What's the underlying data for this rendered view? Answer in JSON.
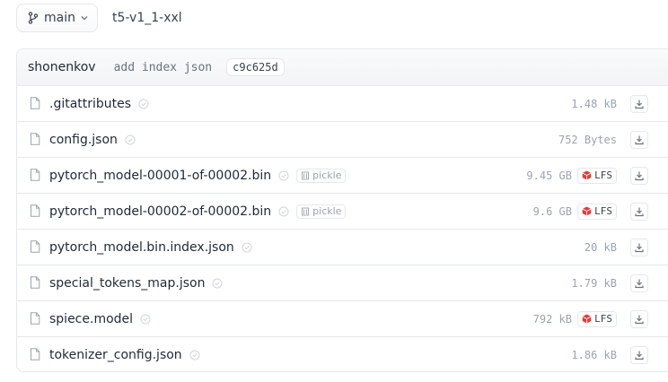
{
  "branch": {
    "label": "main"
  },
  "repo": {
    "path": "t5-v1_1-xxl"
  },
  "commit": {
    "author": "shonenkov",
    "message": "add index json",
    "hash": "c9c625d"
  },
  "files": [
    {
      "name": ".gitattributes",
      "size": "1.48 kB",
      "pickle": null,
      "lfs": null
    },
    {
      "name": "config.json",
      "size": "752 Bytes",
      "pickle": null,
      "lfs": null
    },
    {
      "name": "pytorch_model-00001-of-00002.bin",
      "size": "9.45 GB",
      "pickle": "pickle",
      "lfs": "LFS"
    },
    {
      "name": "pytorch_model-00002-of-00002.bin",
      "size": "9.6 GB",
      "pickle": "pickle",
      "lfs": "LFS"
    },
    {
      "name": "pytorch_model.bin.index.json",
      "size": "20 kB",
      "pickle": null,
      "lfs": null
    },
    {
      "name": "special_tokens_map.json",
      "size": "1.79 kB",
      "pickle": null,
      "lfs": null
    },
    {
      "name": "spiece.model",
      "size": "792 kB",
      "pickle": null,
      "lfs": "LFS"
    },
    {
      "name": "tokenizer_config.json",
      "size": "1.86 kB",
      "pickle": null,
      "lfs": null
    }
  ],
  "colors": {
    "lfs_red": "#e23b3b",
    "border": "#e5e7eb",
    "muted": "#9ca3af"
  }
}
